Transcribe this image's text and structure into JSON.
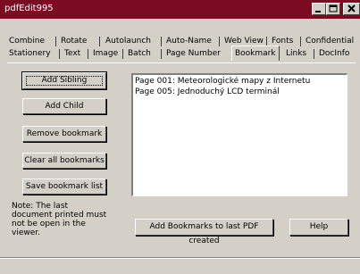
{
  "window": {
    "title": "pdfEdit995"
  },
  "tabs_row1": [
    "Combine",
    "Rotate",
    "Autolaunch",
    "Auto-Name",
    "Web View",
    "Fonts",
    "Confidential"
  ],
  "tabs_row2": [
    "Stationery",
    "Text",
    "Image",
    "Batch",
    "Page Number",
    "Bookmark",
    "Links",
    "DocInfo"
  ],
  "active_tab": "Bookmark",
  "buttons": {
    "add_sibling": "Add Sibling",
    "add_child": "Add Child",
    "remove_bookmark": "Remove bookmark",
    "clear_all": "Clear all bookmarks",
    "save_list": "Save bookmark list",
    "add_to_last_pdf": "Add Bookmarks to last PDF created",
    "help": "Help"
  },
  "bookmarks": [
    "Page 001: Meteorologické mapy z Internetu",
    "Page 005: Jednoduchý LCD terminál"
  ],
  "note": "Note: The last document printed must not be open in the viewer.",
  "colors": {
    "titlebar": "#7a0b22",
    "face": "#d4d0c8"
  }
}
